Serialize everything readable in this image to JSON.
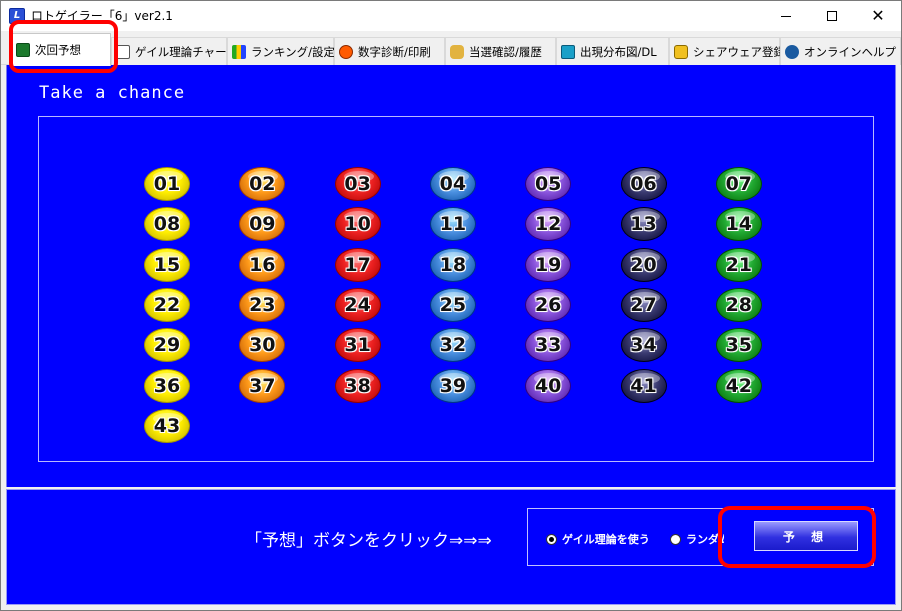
{
  "window": {
    "title": "ロトゲイラー「6」ver2.1"
  },
  "tabs": [
    {
      "label": "次回予想",
      "icon": "chart-icon",
      "active": true
    },
    {
      "label": "ゲイル理論チャート",
      "icon": "calendar-icon",
      "active": false
    },
    {
      "label": "ランキング/設定",
      "icon": "bar-chart-icon",
      "active": false
    },
    {
      "label": "数字診断/印刷",
      "icon": "face-icon",
      "active": false
    },
    {
      "label": "当選確認/履歴",
      "icon": "people-icon",
      "active": false
    },
    {
      "label": "出現分布図/DL",
      "icon": "book-icon",
      "active": false
    },
    {
      "label": "シェアウェア登録",
      "icon": "lock-icon",
      "active": false
    },
    {
      "label": "オンラインヘルプ",
      "icon": "help-icon",
      "active": false
    }
  ],
  "main": {
    "heading": "Take a chance",
    "balls": [
      "01",
      "02",
      "03",
      "04",
      "05",
      "06",
      "07",
      "08",
      "09",
      "10",
      "11",
      "12",
      "13",
      "14",
      "15",
      "16",
      "17",
      "18",
      "19",
      "20",
      "21",
      "22",
      "23",
      "24",
      "25",
      "26",
      "27",
      "28",
      "29",
      "30",
      "31",
      "32",
      "33",
      "34",
      "35",
      "36",
      "37",
      "38",
      "39",
      "40",
      "41",
      "42",
      "43"
    ]
  },
  "bottom": {
    "instruction": "「予想」ボタンをクリック⇒⇒⇒",
    "radio_options": [
      {
        "label": "ゲイル理論を使う",
        "selected": true
      },
      {
        "label": "ランダム",
        "selected": false
      }
    ],
    "predict_button": "予 想"
  },
  "colors": {
    "panel_blue": "#0000ff",
    "highlight_red": "#ff0000",
    "column_colors": [
      "#ffee00",
      "#ff9a1a",
      "#ee2222",
      "#4a8fe0",
      "#8a55dd",
      "#3a3a70",
      "#22aa33"
    ]
  }
}
